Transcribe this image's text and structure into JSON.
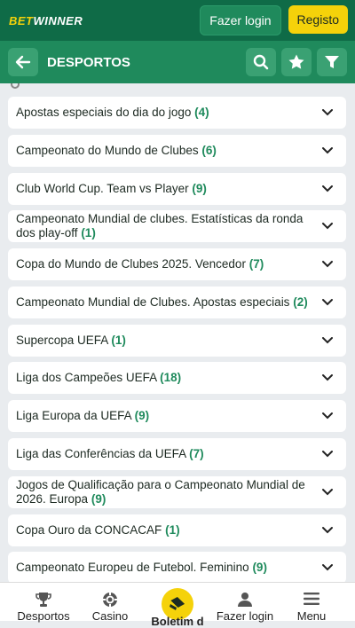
{
  "header": {
    "logo_a": "BET",
    "logo_b": "WINNER",
    "login_label": "Fazer login",
    "register_label": "Registo"
  },
  "section": {
    "title": "DESPORTOS"
  },
  "list": [
    {
      "name": "Apostas especiais do dia do jogo",
      "count": "(4)"
    },
    {
      "name": "Campeonato do Mundo de Clubes",
      "count": "(6)"
    },
    {
      "name": "Club World Cup. Team vs Player",
      "count": "(9)"
    },
    {
      "name": "Campeonato Mundial de clubes. Estatísticas da ronda dos play-off",
      "count": "(1)"
    },
    {
      "name": "Copa do Mundo de Clubes 2025. Vencedor",
      "count": "(7)"
    },
    {
      "name": "Campeonato Mundial de Clubes. Apostas especiais",
      "count": "(2)"
    },
    {
      "name": "Supercopa UEFA",
      "count": "(1)"
    },
    {
      "name": "Liga dos Campeões UEFA",
      "count": "(18)"
    },
    {
      "name": "Liga Europa da UEFA",
      "count": "(9)"
    },
    {
      "name": "Liga das Conferências da UEFA",
      "count": "(7)"
    },
    {
      "name": "Jogos de Qualificação para o Campeonato Mundial de 2026. Europa",
      "count": "(9)"
    },
    {
      "name": "Copa Ouro da CONCACAF",
      "count": "(1)"
    },
    {
      "name": "Campeonato Europeu de Futebol. Feminino",
      "count": "(9)"
    }
  ],
  "nav": {
    "sports": "Desportos",
    "casino": "Casino",
    "betslip": "Boletim d",
    "login": "Fazer login",
    "menu": "Menu"
  },
  "colors": {
    "brand_dark": "#0f6b47",
    "brand": "#1f8a5c",
    "accent": "#f5d20a"
  }
}
